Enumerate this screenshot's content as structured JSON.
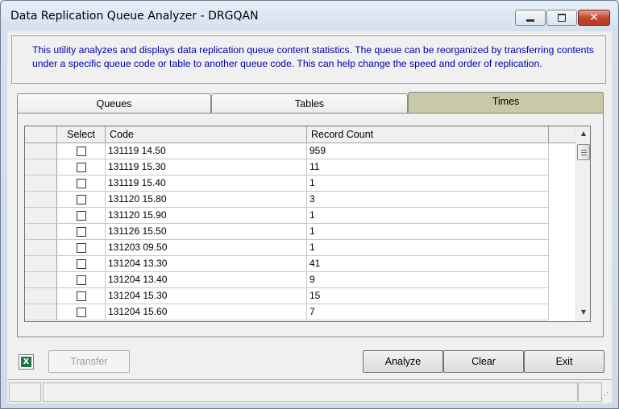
{
  "window": {
    "title": "Data Replication Queue Analyzer - DRGQAN"
  },
  "info_text": "This utility analyzes and displays data replication queue content statistics. The queue can be reorganized by transferring contents under a specific queue code or table to another queue code. This can help change the speed and order of replication.",
  "tabs": [
    {
      "label": "Queues"
    },
    {
      "label": "Tables"
    },
    {
      "label": "Times",
      "selected": true
    }
  ],
  "grid": {
    "columns": {
      "select": "Select",
      "code": "Code",
      "record_count": "Record Count"
    },
    "rows": [
      {
        "code": "131119 14.50",
        "count": "959"
      },
      {
        "code": "131119 15.30",
        "count": "11"
      },
      {
        "code": "131119 15.40",
        "count": "1"
      },
      {
        "code": "131120 15.80",
        "count": "3"
      },
      {
        "code": "131120 15.90",
        "count": "1"
      },
      {
        "code": "131126 15.50",
        "count": "1"
      },
      {
        "code": "131203 09.50",
        "count": "1"
      },
      {
        "code": "131204 13.30",
        "count": "41"
      },
      {
        "code": "131204 13.40",
        "count": "9"
      },
      {
        "code": "131204 15.30",
        "count": "15"
      },
      {
        "code": "131204 15.60",
        "count": "7"
      }
    ]
  },
  "buttons": {
    "transfer": "Transfer",
    "analyze": "Analyze",
    "clear": "Clear",
    "exit": "Exit"
  },
  "icons": {
    "excel": "excel-export-icon",
    "min": "minimize-icon",
    "max": "maximize-icon",
    "close": "close-icon"
  },
  "colors": {
    "info_text": "#0000aa",
    "selected_tab": "#c9c9a9"
  }
}
